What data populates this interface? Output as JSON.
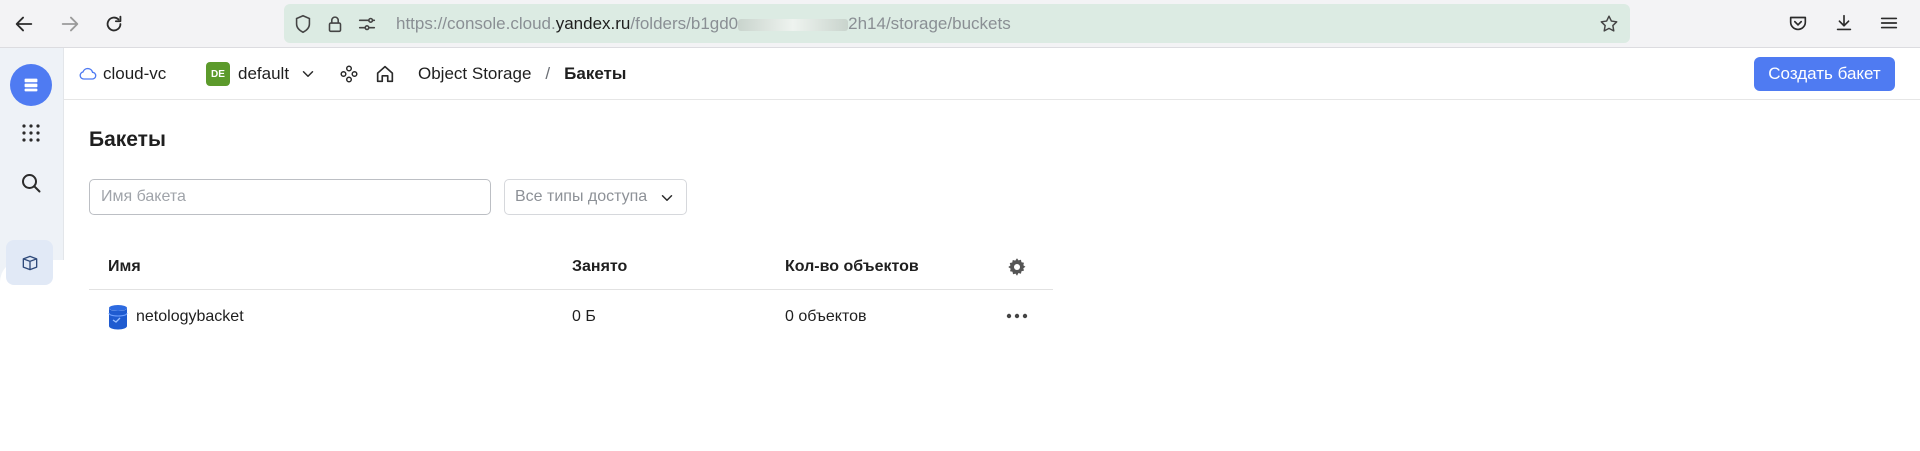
{
  "browser": {
    "url_prefix": "https://console.cloud.",
    "url_host": "yandex.ru",
    "url_path": "/folders/b1gd0",
    "url_path_end": "2h14/storage/buckets"
  },
  "header": {
    "cloud_name": "cloud-vc",
    "folder_badge": "DE",
    "folder_name": "default",
    "service": "Object Storage",
    "separator": "/",
    "current": "Бакеты",
    "create_button": "Создать бакет"
  },
  "main": {
    "title": "Бакеты",
    "search_placeholder": "Имя бакета",
    "access_filter": "Все типы доступа"
  },
  "table": {
    "columns": [
      "Имя",
      "Занято",
      "Кол-во объектов"
    ],
    "rows": [
      {
        "name": "netologybacket",
        "size": "0 Б",
        "objects": "0 объектов"
      }
    ]
  },
  "colors": {
    "accent": "#4f7bf2",
    "folder_badge": "#5c9a2b",
    "url_bar": "#dcebe3"
  }
}
